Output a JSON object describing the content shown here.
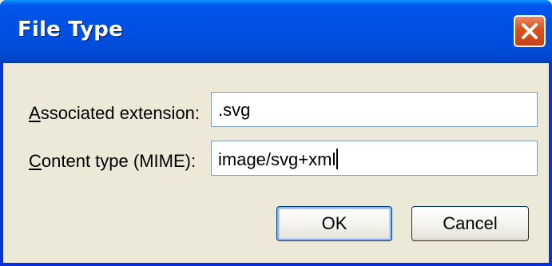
{
  "dialog": {
    "title": "File Type",
    "close_icon": "close-icon"
  },
  "fields": {
    "extension": {
      "label_mnemonic": "A",
      "label_rest": "ssociated extension:",
      "value": ".svg"
    },
    "mime": {
      "label_mnemonic": "C",
      "label_rest": "ontent type (MIME):",
      "value": "image/svg+xml"
    }
  },
  "buttons": {
    "ok_label": "OK",
    "cancel_label": "Cancel"
  },
  "colors": {
    "titlebar": "#0050e1",
    "close_button": "#d9531f",
    "window_body": "#ece9d8",
    "textbox_border": "#7f9db9"
  }
}
